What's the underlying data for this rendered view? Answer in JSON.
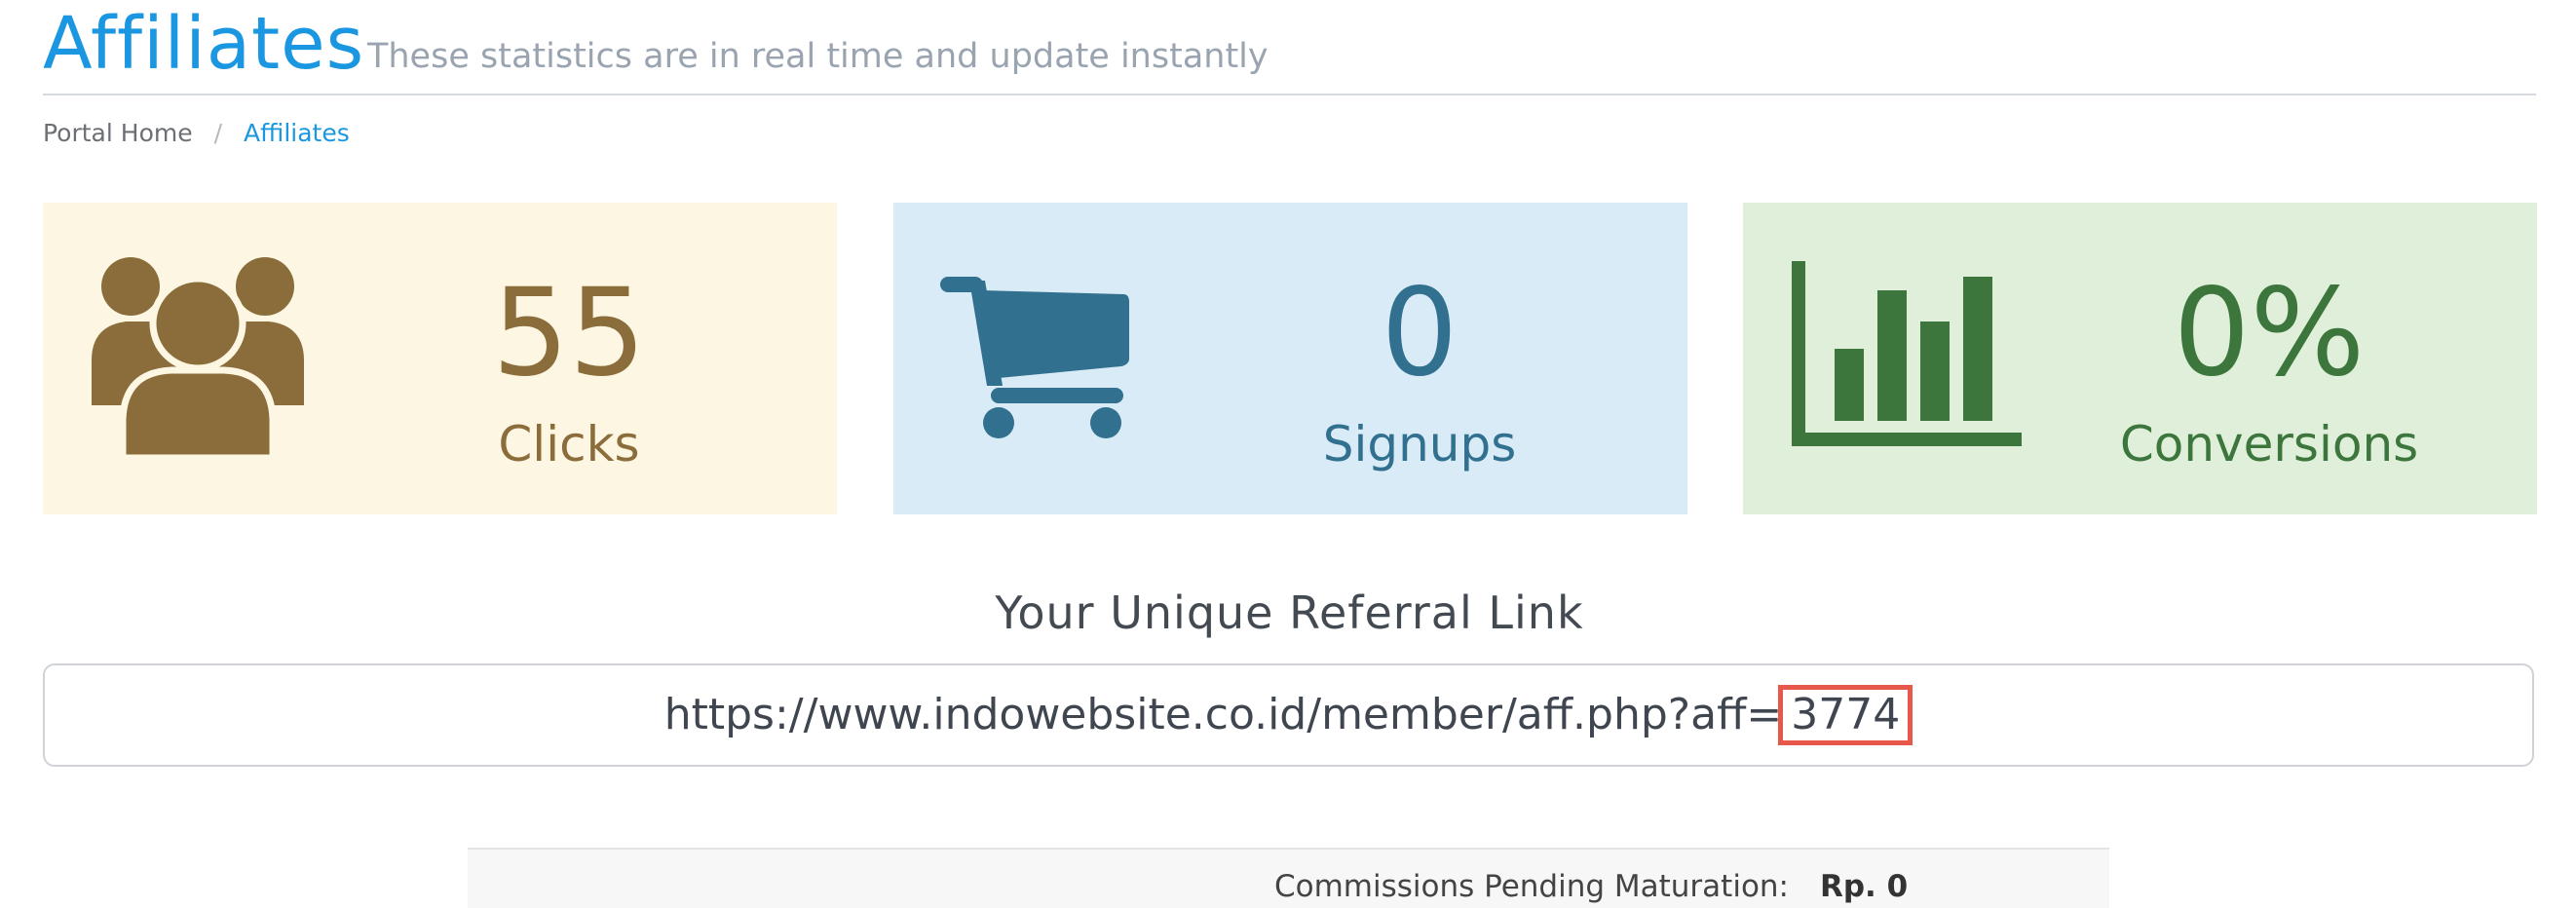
{
  "header": {
    "title": "Affiliates",
    "subtitle": "These statistics are in real time and update instantly"
  },
  "breadcrumb": {
    "home": "Portal Home",
    "separator": "/",
    "current": "Affiliates"
  },
  "stats": {
    "clicks": {
      "value": "55",
      "label": "Clicks",
      "icon": "users-icon",
      "color": "#8a6d3b",
      "background": "#fcf6e2"
    },
    "signups": {
      "value": "0",
      "label": "Signups",
      "icon": "shopping-cart-icon",
      "color": "#31708f",
      "background": "#d9ebf6"
    },
    "conversions": {
      "value": "0%",
      "label": "Conversions",
      "icon": "bar-chart-icon",
      "color": "#3c763d",
      "background": "#dfefd9"
    }
  },
  "referral": {
    "heading": "Your Unique Referral Link",
    "url_prefix": "https://www.indowebsite.co.id/member/aff.php?aff=",
    "affiliate_id": "3774",
    "highlight_color": "#e8584a"
  },
  "commissions": {
    "pending_label": "Commissions Pending Maturation:",
    "pending_value": "Rp. 0"
  },
  "colors": {
    "accent": "#1a97e0",
    "muted_text": "#9aa4b0"
  }
}
